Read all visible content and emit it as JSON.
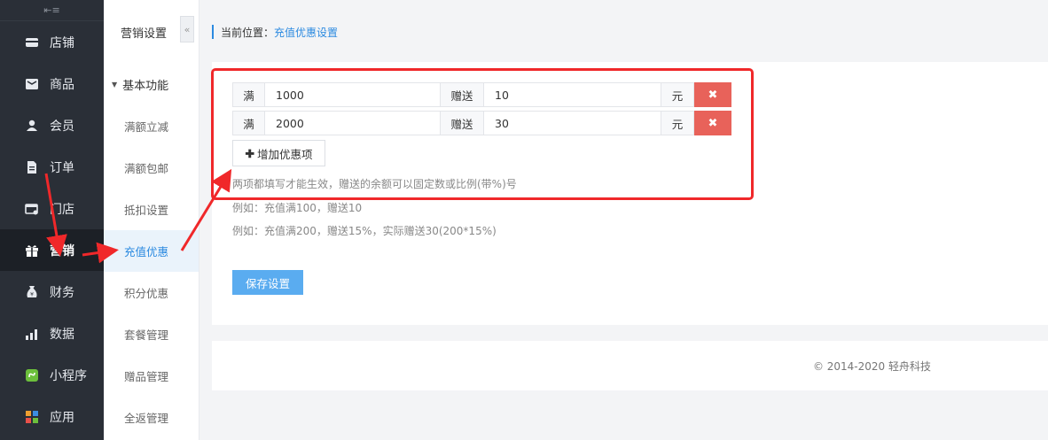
{
  "sidebar": {
    "collapse_glyph": "⇤≡",
    "items": [
      {
        "label": "店铺",
        "icon": "store-icon"
      },
      {
        "label": "商品",
        "icon": "goods-icon"
      },
      {
        "label": "会员",
        "icon": "user-icon"
      },
      {
        "label": "订单",
        "icon": "order-icon"
      },
      {
        "label": "门店",
        "icon": "shop-icon"
      },
      {
        "label": "营销",
        "icon": "gift-icon"
      },
      {
        "label": "财务",
        "icon": "money-bag-icon"
      },
      {
        "label": "数据",
        "icon": "bar-chart-icon"
      },
      {
        "label": "小程序",
        "icon": "mini-program-icon"
      },
      {
        "label": "应用",
        "icon": "apps-icon"
      }
    ],
    "active_index": 5
  },
  "subnav": {
    "title": "营销设置",
    "collapse_glyph": "«",
    "group_label": "基本功能",
    "items": [
      "满额立减",
      "满额包邮",
      "抵扣设置",
      "充值优惠",
      "积分优惠",
      "套餐管理",
      "赠品管理",
      "全返管理"
    ],
    "active_index": 3
  },
  "breadcrumb": {
    "prefix": "当前位置：",
    "current": "充值优惠设置"
  },
  "form": {
    "rows": [
      {
        "label_full": "满",
        "amount": "1000",
        "label_gift": "赠送",
        "gift": "10",
        "unit": "元"
      },
      {
        "label_full": "满",
        "amount": "2000",
        "label_gift": "赠送",
        "gift": "30",
        "unit": "元"
      }
    ],
    "delete_glyph": "✖",
    "add_label": "增加优惠项",
    "add_glyph": "✚",
    "hints": [
      "两项都填写才能生效，赠送的余额可以固定数或比例(带%)号",
      "例如：充值满100，赠送10",
      "例如：充值满200，赠送15%，实际赠送30(200*15%)"
    ],
    "save_label": "保存设置"
  },
  "footer": {
    "copyright": "© 2014-2020 轻舟科技"
  },
  "colors": {
    "accent": "#2b8ae0",
    "danger": "#e8625a",
    "annotation": "#f0282a",
    "sidebar_bg": "#2a2f37"
  }
}
